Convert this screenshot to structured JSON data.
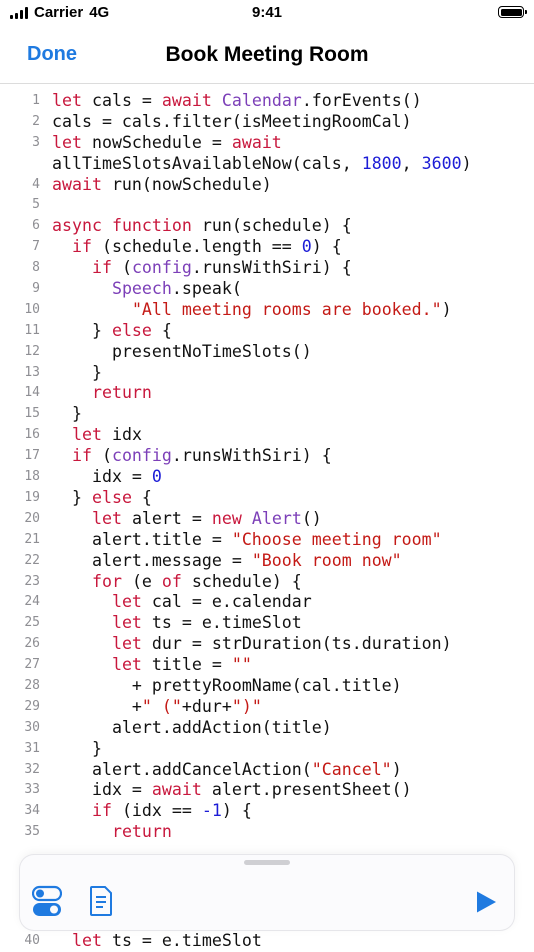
{
  "status_bar": {
    "carrier": "Carrier",
    "network": "4G",
    "time": "9:41"
  },
  "nav": {
    "done_label": "Done",
    "title": "Book Meeting Room"
  },
  "colors": {
    "accent": "#1f7ae0",
    "keyword": "#c8183d",
    "type": "#7c3fb8",
    "number": "#1c1cd6",
    "string": "#c41a16"
  },
  "toolbar": {
    "icons": [
      "toggles-icon",
      "document-icon",
      "play-icon"
    ]
  },
  "code_lines": [
    {
      "n": "1",
      "tokens": [
        [
          "k",
          "let"
        ],
        [
          "p",
          " cals = "
        ],
        [
          "k",
          "await"
        ],
        [
          "p",
          " "
        ],
        [
          "t",
          "Calendar"
        ],
        [
          "p",
          ".forEvents()"
        ]
      ]
    },
    {
      "n": "2",
      "tokens": [
        [
          "p",
          "cals = cals.filter(isMeetingRoomCal)"
        ]
      ]
    },
    {
      "n": "3",
      "wrap": true,
      "tokens": [
        [
          "k",
          "let"
        ],
        [
          "p",
          " nowSchedule = "
        ],
        [
          "k",
          "await"
        ],
        [
          "p",
          "\nallTimeSlotsAvailableNow(cals, "
        ],
        [
          "n",
          "1800"
        ],
        [
          "p",
          ", "
        ],
        [
          "n",
          "3600"
        ],
        [
          "p",
          ")"
        ]
      ]
    },
    {
      "n": "4",
      "tokens": [
        [
          "k",
          "await"
        ],
        [
          "p",
          " run(nowSchedule)"
        ]
      ]
    },
    {
      "n": "5",
      "tokens": []
    },
    {
      "n": "6",
      "tokens": [
        [
          "k",
          "async"
        ],
        [
          "p",
          " "
        ],
        [
          "k",
          "function"
        ],
        [
          "p",
          " run(schedule) {"
        ]
      ]
    },
    {
      "n": "7",
      "tokens": [
        [
          "p",
          "  "
        ],
        [
          "k",
          "if"
        ],
        [
          "p",
          " (schedule.length == "
        ],
        [
          "n",
          "0"
        ],
        [
          "p",
          ") {"
        ]
      ]
    },
    {
      "n": "8",
      "tokens": [
        [
          "p",
          "    "
        ],
        [
          "k",
          "if"
        ],
        [
          "p",
          " ("
        ],
        [
          "t",
          "config"
        ],
        [
          "p",
          ".runsWithSiri) {"
        ]
      ]
    },
    {
      "n": "9",
      "tokens": [
        [
          "p",
          "      "
        ],
        [
          "t",
          "Speech"
        ],
        [
          "p",
          ".speak("
        ]
      ]
    },
    {
      "n": "10",
      "tokens": [
        [
          "p",
          "        "
        ],
        [
          "s",
          "\"All meeting rooms are booked.\""
        ],
        [
          "p",
          ")"
        ]
      ]
    },
    {
      "n": "11",
      "tokens": [
        [
          "p",
          "    } "
        ],
        [
          "k",
          "else"
        ],
        [
          "p",
          " {"
        ]
      ]
    },
    {
      "n": "12",
      "tokens": [
        [
          "p",
          "      presentNoTimeSlots()"
        ]
      ]
    },
    {
      "n": "13",
      "tokens": [
        [
          "p",
          "    }"
        ]
      ]
    },
    {
      "n": "14",
      "tokens": [
        [
          "p",
          "    "
        ],
        [
          "k",
          "return"
        ]
      ]
    },
    {
      "n": "15",
      "tokens": [
        [
          "p",
          "  }"
        ]
      ]
    },
    {
      "n": "16",
      "tokens": [
        [
          "p",
          "  "
        ],
        [
          "k",
          "let"
        ],
        [
          "p",
          " idx"
        ]
      ]
    },
    {
      "n": "17",
      "tokens": [
        [
          "p",
          "  "
        ],
        [
          "k",
          "if"
        ],
        [
          "p",
          " ("
        ],
        [
          "t",
          "config"
        ],
        [
          "p",
          ".runsWithSiri) {"
        ]
      ]
    },
    {
      "n": "18",
      "tokens": [
        [
          "p",
          "    idx = "
        ],
        [
          "n",
          "0"
        ]
      ]
    },
    {
      "n": "19",
      "tokens": [
        [
          "p",
          "  } "
        ],
        [
          "k",
          "else"
        ],
        [
          "p",
          " {"
        ]
      ]
    },
    {
      "n": "20",
      "tokens": [
        [
          "p",
          "    "
        ],
        [
          "k",
          "let"
        ],
        [
          "p",
          " alert = "
        ],
        [
          "k",
          "new"
        ],
        [
          "p",
          " "
        ],
        [
          "t",
          "Alert"
        ],
        [
          "p",
          "()"
        ]
      ]
    },
    {
      "n": "21",
      "tokens": [
        [
          "p",
          "    alert.title = "
        ],
        [
          "s",
          "\"Choose meeting room\""
        ]
      ]
    },
    {
      "n": "22",
      "tokens": [
        [
          "p",
          "    alert.message = "
        ],
        [
          "s",
          "\"Book room now\""
        ]
      ]
    },
    {
      "n": "23",
      "tokens": [
        [
          "p",
          "    "
        ],
        [
          "k",
          "for"
        ],
        [
          "p",
          " (e "
        ],
        [
          "k",
          "of"
        ],
        [
          "p",
          " schedule) {"
        ]
      ]
    },
    {
      "n": "24",
      "tokens": [
        [
          "p",
          "      "
        ],
        [
          "k",
          "let"
        ],
        [
          "p",
          " cal = e.calendar"
        ]
      ]
    },
    {
      "n": "25",
      "tokens": [
        [
          "p",
          "      "
        ],
        [
          "k",
          "let"
        ],
        [
          "p",
          " ts = e.timeSlot"
        ]
      ]
    },
    {
      "n": "26",
      "tokens": [
        [
          "p",
          "      "
        ],
        [
          "k",
          "let"
        ],
        [
          "p",
          " dur = strDuration(ts.duration)"
        ]
      ]
    },
    {
      "n": "27",
      "tokens": [
        [
          "p",
          "      "
        ],
        [
          "k",
          "let"
        ],
        [
          "p",
          " title = "
        ],
        [
          "s",
          "\"\""
        ]
      ]
    },
    {
      "n": "28",
      "tokens": [
        [
          "p",
          "        + prettyRoomName(cal.title)"
        ]
      ]
    },
    {
      "n": "29",
      "tokens": [
        [
          "p",
          "        +"
        ],
        [
          "s",
          "\" (\""
        ],
        [
          "p",
          "+dur+"
        ],
        [
          "s",
          "\")\""
        ]
      ]
    },
    {
      "n": "30",
      "tokens": [
        [
          "p",
          "      alert.addAction(title)"
        ]
      ]
    },
    {
      "n": "31",
      "tokens": [
        [
          "p",
          "    }"
        ]
      ]
    },
    {
      "n": "32",
      "tokens": [
        [
          "p",
          "    alert.addCancelAction("
        ],
        [
          "s",
          "\"Cancel\""
        ],
        [
          "p",
          ")"
        ]
      ]
    },
    {
      "n": "33",
      "tokens": [
        [
          "p",
          "    idx = "
        ],
        [
          "k",
          "await"
        ],
        [
          "p",
          " alert.presentSheet()"
        ]
      ]
    },
    {
      "n": "34",
      "tokens": [
        [
          "p",
          "    "
        ],
        [
          "k",
          "if"
        ],
        [
          "p",
          " (idx == "
        ],
        [
          "n",
          "-1"
        ],
        [
          "p",
          ") {"
        ]
      ]
    },
    {
      "n": "35",
      "tokens": [
        [
          "p",
          "      "
        ],
        [
          "k",
          "return"
        ]
      ]
    }
  ],
  "last_line": {
    "n": "40",
    "tokens": [
      [
        "p",
        "  "
      ],
      [
        "k",
        "let"
      ],
      [
        "p",
        " ts = e.timeSlot"
      ]
    ]
  }
}
